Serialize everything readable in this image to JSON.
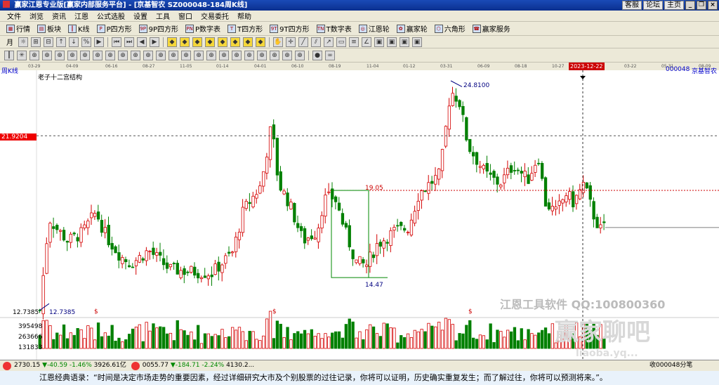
{
  "window": {
    "title": "赢家江恩专业版[赢家内部服务平台] - [京基智农  SZ000048-184周K线]",
    "links": [
      "客服",
      "论坛",
      "主页"
    ]
  },
  "menu": [
    "文件",
    "浏览",
    "资讯",
    "江恩",
    "公式选股",
    "设置",
    "工具",
    "窗口",
    "交易委托",
    "帮助"
  ],
  "toolbar1": [
    {
      "icon": "grid-icon",
      "label": "行情"
    },
    {
      "icon": "blocks-icon",
      "label": "板块"
    },
    {
      "icon": "kline-icon",
      "label": "K线"
    },
    {
      "icon": "p-square-icon",
      "label": "P四方形"
    },
    {
      "icon": "9p-square-icon",
      "label": "9P四方形"
    },
    {
      "icon": "pn-table-icon",
      "label": "P数字表"
    },
    {
      "icon": "t-square-icon",
      "label": "T四方形"
    },
    {
      "icon": "9t-square-icon",
      "label": "9T四方形"
    },
    {
      "icon": "tn-table-icon",
      "label": "T数字表"
    },
    {
      "icon": "gann-wheel-icon",
      "label": "江恩轮"
    },
    {
      "icon": "winner-wheel-icon",
      "label": "赢家轮"
    },
    {
      "icon": "hexagon-icon",
      "label": "六角形"
    },
    {
      "icon": "service-icon",
      "label": "赢家服务"
    }
  ],
  "period_selector": "月",
  "date_axis": {
    "ticks": [
      "03-29",
      "04-09",
      "06-16",
      "08-27",
      "11-05",
      "01-14",
      "04-01",
      "06-10",
      "08-19",
      "11-04",
      "01-12",
      "03-31",
      "06-09",
      "08-18",
      "10-27",
      "03-22",
      "05-31",
      "08-09"
    ],
    "selected": "2023-12-22"
  },
  "chart_header": {
    "period_label": "周K线",
    "indicator_name": "老子十二宫结构",
    "stock_code": "000048",
    "stock_name": "京基智农",
    "cursor_price": "21.9204",
    "level_1905": "19.05",
    "low_label": "12.7385",
    "low_label_axis": "12.7385",
    "high_label": "24.8100",
    "box_low_label": "14.47",
    "vol_axis": [
      "395498",
      "263666",
      "131833"
    ],
    "watermark_1": "江恩工具软件  QQ:100800360",
    "watermark_2": "赢家聊吧",
    "watermark_3": "liaoba.yq..."
  },
  "chart_data": {
    "type": "candlestick",
    "title": "老子十二宫结构",
    "x": [
      "03-29",
      "04-09",
      "06-16",
      "08-27",
      "11-05",
      "01-14",
      "04-01",
      "06-10",
      "08-19",
      "11-04",
      "01-12",
      "03-31",
      "06-09",
      "08-18",
      "10-27",
      "2023-12-22",
      "03-22",
      "05-31",
      "08-09"
    ],
    "price_range": [
      12.7385,
      24.81
    ],
    "annotated_prices": [
      24.81,
      21.9204,
      19.05,
      14.47,
      12.7385
    ],
    "volume_ticks": [
      395498,
      263666,
      131833
    ]
  },
  "status": {
    "index1": "2730.15",
    "index1_change": "▼-40.59",
    "index1_pct": "-1.46%",
    "index1_amount": "3926.61亿",
    "index2": "0055.77",
    "index2_change": "▼-184.71",
    "index2_pct": "-2.24%",
    "index2_amount": "4130.2...",
    "right": "收000048分笔"
  },
  "quote": "江恩经典语录：“时间是决定市场走势的重要因素，经过详细研究大市及个别股票的过往记录，你将可以证明，历史确实重复发生；而了解过往，你将可以预测将来。”。",
  "colors": {
    "up": "#d40000",
    "down": "#008000",
    "accent": "#1a4bb7"
  }
}
